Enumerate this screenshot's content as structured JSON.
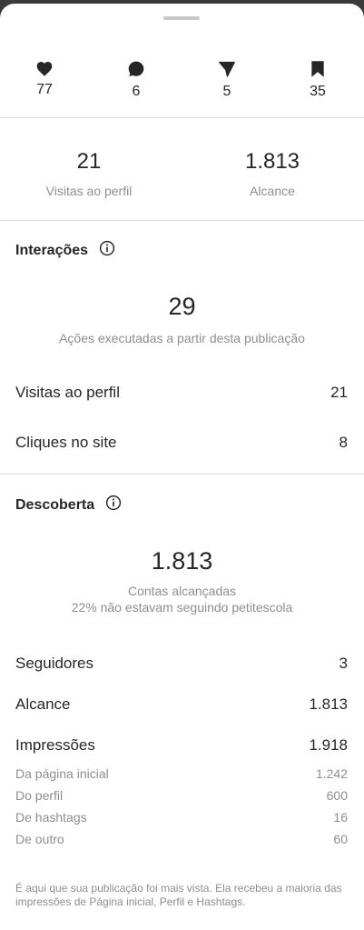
{
  "top_stats": {
    "likes": "77",
    "comments": "6",
    "shares": "5",
    "saves": "35"
  },
  "summary": {
    "profile_visits_value": "21",
    "profile_visits_label": "Visitas ao perfil",
    "reach_value": "1.813",
    "reach_label": "Alcance"
  },
  "interactions": {
    "title": "Interações",
    "total": "29",
    "total_label": "Ações executadas a partir desta publicação",
    "rows": [
      {
        "label": "Visitas ao perfil",
        "value": "21"
      },
      {
        "label": "Cliques no site",
        "value": "8"
      }
    ]
  },
  "discovery": {
    "title": "Descoberta",
    "total": "1.813",
    "total_label": "Contas alcançadas",
    "total_sub": "22% não estavam seguindo petitescola",
    "rows": [
      {
        "label": "Seguidores",
        "value": "3"
      },
      {
        "label": "Alcance",
        "value": "1.813"
      },
      {
        "label": "Impressões",
        "value": "1.918"
      }
    ],
    "impressions_breakdown": [
      {
        "label": "Da página inicial",
        "value": "1.242"
      },
      {
        "label": "Do perfil",
        "value": "600"
      },
      {
        "label": "De hashtags",
        "value": "16"
      },
      {
        "label": "De outro",
        "value": "60"
      }
    ],
    "footer": "É aqui que sua publicação foi mais vista. Ela recebeu a maioria das impressões de Página inicial, Perfil e Hashtags."
  },
  "icons": {
    "likes": "heart-icon",
    "comments": "comment-icon",
    "shares": "send-icon",
    "saves": "bookmark-icon",
    "info": "info-icon"
  }
}
